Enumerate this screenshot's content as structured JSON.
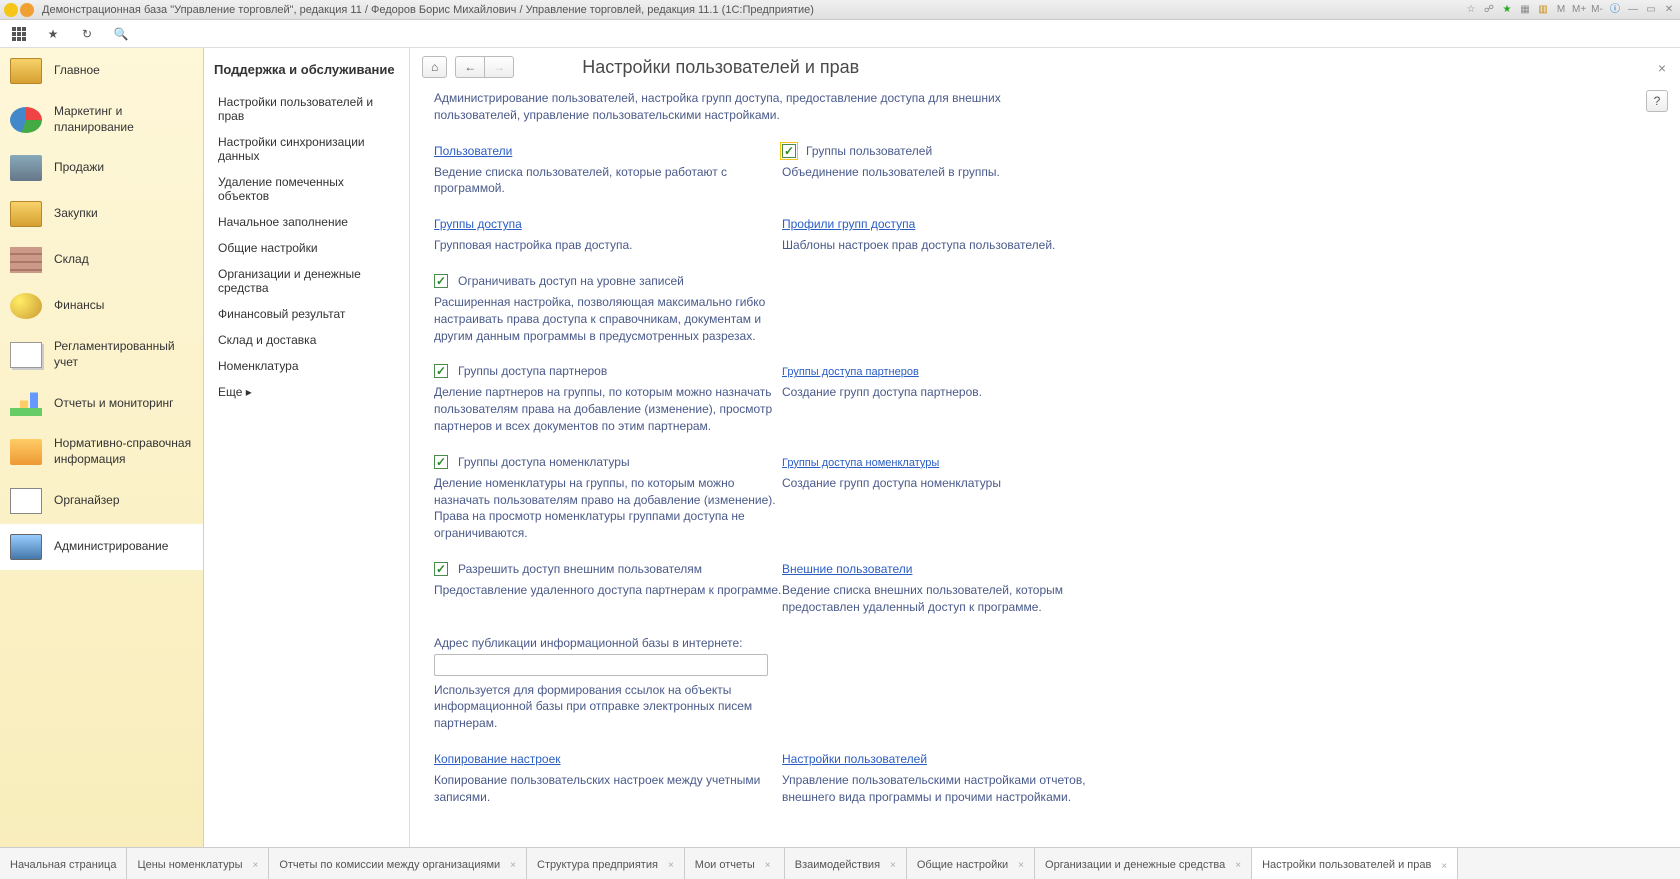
{
  "titlebar": {
    "title": "Демонстрационная база \"Управление торговлей\", редакция 11 / Федоров Борис Михайлович / Управление торговлей, редакция 11.1  (1С:Предприятие)",
    "right_labels": [
      "M",
      "M+",
      "M-"
    ]
  },
  "nav": {
    "items": [
      {
        "label": "Главное"
      },
      {
        "label": "Маркетинг и планирование"
      },
      {
        "label": "Продажи"
      },
      {
        "label": "Закупки"
      },
      {
        "label": "Склад"
      },
      {
        "label": "Финансы"
      },
      {
        "label": "Регламентированный учет"
      },
      {
        "label": "Отчеты и мониторинг"
      },
      {
        "label": "Нормативно-справочная информация"
      },
      {
        "label": "Органайзер"
      },
      {
        "label": "Администрирование"
      }
    ]
  },
  "side2": {
    "heading": "Поддержка и обслуживание",
    "items": [
      "Настройки пользователей и прав",
      "Настройки синхронизации данных",
      "Удаление помеченных объектов",
      "Начальное заполнение",
      "Общие настройки",
      "Организации и денежные средства",
      "Финансовый результат",
      "Склад и доставка",
      "Номенклатура",
      "Еще  ▸"
    ]
  },
  "page": {
    "title": "Настройки пользователей и прав",
    "intro": "Администрирование пользователей, настройка групп доступа, предоставление доступа для внешних пользователей, управление пользовательскими настройками.",
    "help": "?",
    "close": "×",
    "home": "⌂",
    "back": "←",
    "fwd": "→"
  },
  "content": {
    "r1": {
      "l_link": "Пользователи",
      "l_desc": "Ведение списка пользователей, которые работают с программой.",
      "r_chk_label": "Группы пользователей",
      "r_desc": "Объединение пользователей в группы."
    },
    "r2": {
      "l_link": "Группы доступа",
      "l_desc": "Групповая настройка прав доступа.",
      "r_link": "Профили групп доступа",
      "r_desc": "Шаблоны настроек прав доступа пользователей."
    },
    "r3": {
      "chk_label": "Ограничивать доступ на уровне записей",
      "desc": "Расширенная настройка, позволяющая максимально гибко настраивать права доступа к справочникам, документам и другим данным программы в предусмотренных разрезах."
    },
    "r4": {
      "chk_label": "Группы доступа партнеров",
      "desc": "Деление партнеров на группы, по которым можно назначать пользователям права на добавление (изменение), просмотр партнеров и всех документов по этим партнерам.",
      "r_link": "Группы доступа партнеров",
      "r_desc": "Создание групп доступа партнеров."
    },
    "r5": {
      "chk_label": "Группы доступа номенклатуры",
      "desc": "Деление номенклатуры на группы, по которым можно назначать пользователям право на добавление (изменение). Права на просмотр номенклатуры группами доступа не ограничиваются.",
      "r_link": "Группы доступа номенклатуры",
      "r_desc": "Создание групп доступа номенклатуры"
    },
    "r6": {
      "chk_label": "Разрешить доступ внешним пользователям",
      "desc": "Предоставление удаленного доступа партнерам к программе.",
      "r_link": "Внешние пользователи",
      "r_desc": "Ведение списка внешних пользователей, которым предоставлен удаленный доступ к программе."
    },
    "r7": {
      "label": "Адрес публикации информационной базы в интернете:",
      "value": "",
      "hint": "Используется для формирования ссылок на объекты информационной базы при отправке электронных писем партнерам."
    },
    "r8": {
      "l_link": "Копирование настроек",
      "l_desc": "Копирование пользовательских настроек между учетными записями.",
      "r_link": "Настройки пользователей",
      "r_desc": "Управление пользовательскими настройками отчетов, внешнего вида программы и прочими настройками."
    }
  },
  "tabs": [
    {
      "label": "Начальная страница",
      "closable": false
    },
    {
      "label": "Цены номенклатуры",
      "closable": true
    },
    {
      "label": "Отчеты по комиссии между организациями",
      "closable": true
    },
    {
      "label": "Структура предприятия",
      "closable": true
    },
    {
      "label": "Мои отчеты",
      "closable": true
    },
    {
      "label": "Взаимодействия",
      "closable": true
    },
    {
      "label": "Общие настройки",
      "closable": true
    },
    {
      "label": "Организации и денежные средства",
      "closable": true
    },
    {
      "label": "Настройки пользователей и прав",
      "closable": true,
      "active": true
    }
  ]
}
